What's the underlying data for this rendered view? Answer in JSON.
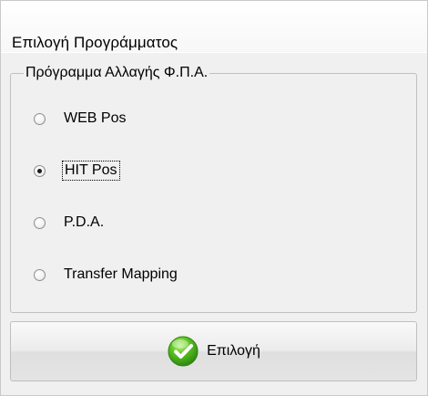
{
  "dialog": {
    "title": "Επιλογή Προγράμματος"
  },
  "group": {
    "legend": "Πρόγραμμα Αλλαγής Φ.Π.Α.",
    "options": [
      {
        "label": "WEB Pos",
        "checked": false
      },
      {
        "label": "HIT Pos",
        "checked": true,
        "focused": true
      },
      {
        "label": "P.D.A.",
        "checked": false
      },
      {
        "label": "Transfer Mapping",
        "checked": false
      }
    ]
  },
  "button": {
    "label": "Επιλογή",
    "icon": "green-check-icon"
  }
}
